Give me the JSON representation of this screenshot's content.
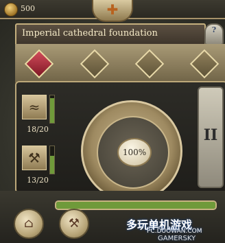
{
  "top_bar": {
    "gold_amount": "500"
  },
  "title": {
    "text": "Imperial cathedral foundation"
  },
  "help": {
    "label": "?"
  },
  "upgrades": {
    "slots": [
      {
        "state": "active"
      },
      {
        "state": "empty"
      },
      {
        "state": "empty"
      },
      {
        "state": "empty"
      }
    ]
  },
  "resources": [
    {
      "icon": "lumber-icon",
      "glyph": "≈",
      "count": "18/20",
      "fill_fraction": 0.9
    },
    {
      "icon": "tools-icon",
      "glyph": "⚒",
      "count": "13/20",
      "fill_fraction": 0.65
    }
  ],
  "dial": {
    "percent": "100%"
  },
  "pause": {
    "label": "II"
  },
  "progress": {
    "fraction": 1.0
  },
  "bottom_buttons": [
    {
      "icon": "house-icon",
      "glyph": "⌂"
    },
    {
      "icon": "hammer-icon",
      "glyph": "⚒"
    }
  ],
  "watermark": {
    "line1": "多玩单机游戏",
    "line2": "PC.DUOWAN.COM",
    "line3": "GAMERSKY"
  },
  "colors": {
    "accent_gold": "#c5b07e",
    "progress_green": "#6f9a3a",
    "active_slot": "#d24c5b"
  }
}
